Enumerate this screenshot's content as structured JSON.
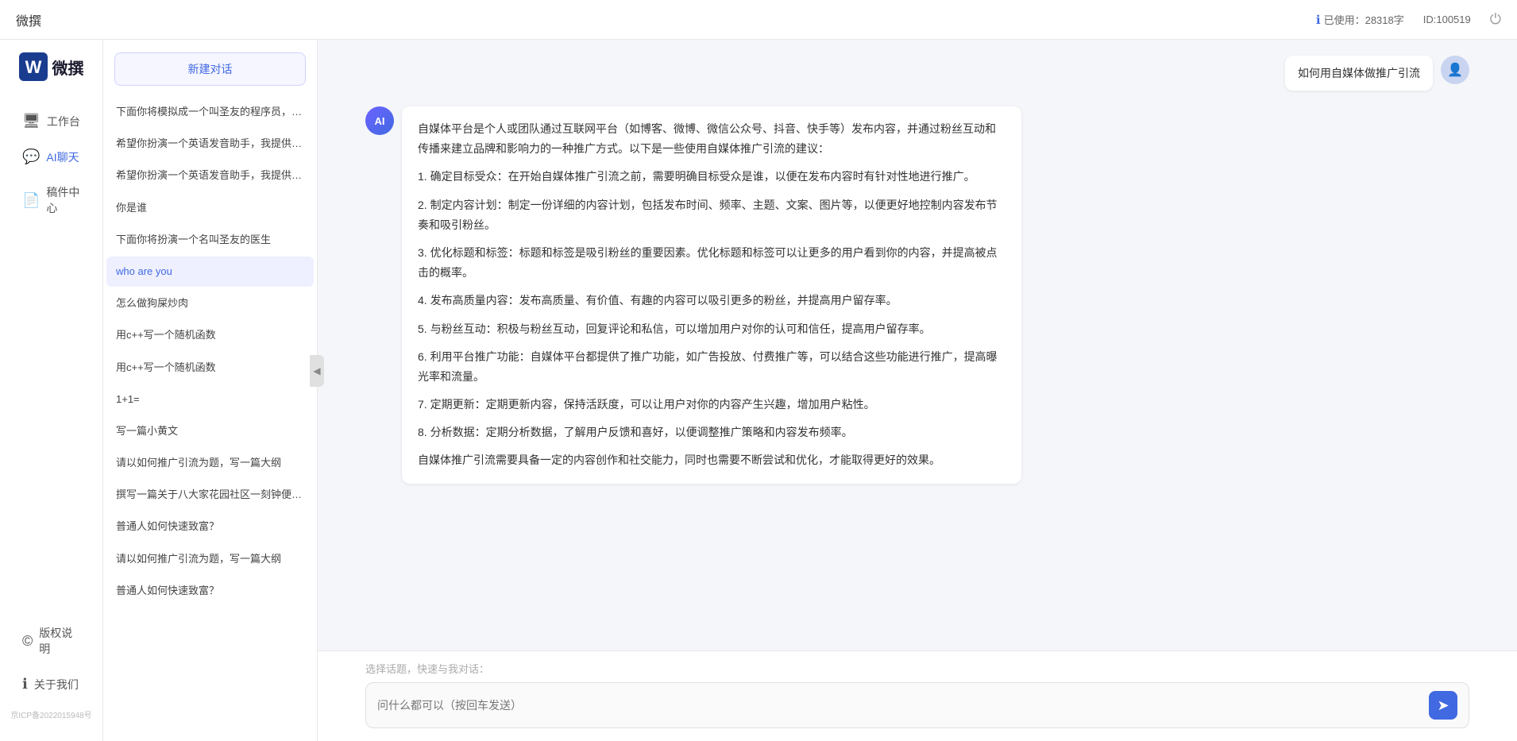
{
  "topbar": {
    "title": "微撰",
    "usage_label": "已使用：28318字",
    "usage_icon": "info-icon",
    "id_label": "ID:100519",
    "power_icon": "power-icon"
  },
  "logo": {
    "text": "微撰",
    "icon_alt": "W logo"
  },
  "nav": {
    "items": [
      {
        "id": "workbench",
        "label": "工作台",
        "icon": "🖥"
      },
      {
        "id": "ai-chat",
        "label": "AI聊天",
        "icon": "💬"
      },
      {
        "id": "drafts",
        "label": "稿件中心",
        "icon": "📄"
      }
    ],
    "bottom_items": [
      {
        "id": "copyright",
        "label": "版权说明",
        "icon": "©"
      },
      {
        "id": "about",
        "label": "关于我们",
        "icon": "ℹ"
      }
    ],
    "icp": "京ICP备2022015948号"
  },
  "conv_panel": {
    "new_btn": "新建对话",
    "items": [
      {
        "id": 1,
        "text": "下面你将模拟成一个叫圣友的程序员，我说...",
        "active": false
      },
      {
        "id": 2,
        "text": "希望你扮演一个英语发音助手，我提供给你...",
        "active": false
      },
      {
        "id": 3,
        "text": "希望你扮演一个英语发音助手，我提供给你...",
        "active": false
      },
      {
        "id": 4,
        "text": "你是谁",
        "active": false
      },
      {
        "id": 5,
        "text": "下面你将扮演一个名叫圣友的医生",
        "active": false
      },
      {
        "id": 6,
        "text": "who are you",
        "active": true
      },
      {
        "id": 7,
        "text": "怎么做狗屎炒肉",
        "active": false
      },
      {
        "id": 8,
        "text": "用c++写一个随机函数",
        "active": false
      },
      {
        "id": 9,
        "text": "用c++写一个随机函数",
        "active": false
      },
      {
        "id": 10,
        "text": "1+1=",
        "active": false
      },
      {
        "id": 11,
        "text": "写一篇小黄文",
        "active": false
      },
      {
        "id": 12,
        "text": "请以如何推广引流为题，写一篇大纲",
        "active": false
      },
      {
        "id": 13,
        "text": "撰写一篇关于八大家花园社区一刻钟便民生...",
        "active": false
      },
      {
        "id": 14,
        "text": "普通人如何快速致富？",
        "active": false
      },
      {
        "id": 15,
        "text": "请以如何推广引流为题，写一篇大纲",
        "active": false
      },
      {
        "id": 16,
        "text": "普通人如何快速致富？",
        "active": false
      }
    ]
  },
  "chat": {
    "user_message": "如何用自媒体做推广引流",
    "ai_response": {
      "paragraphs": [
        "自媒体平台是个人或团队通过互联网平台（如博客、微博、微信公众号、抖音、快手等）发布内容，并通过粉丝互动和传播来建立品牌和影响力的一种推广方式。以下是一些使用自媒体推广引流的建议：",
        "1. 确定目标受众：在开始自媒体推广引流之前，需要明确目标受众是谁，以便在发布内容时有针对性地进行推广。",
        "2. 制定内容计划：制定一份详细的内容计划，包括发布时间、频率、主题、文案、图片等，以便更好地控制内容发布节奏和吸引粉丝。",
        "3. 优化标题和标签：标题和标签是吸引粉丝的重要因素。优化标题和标签可以让更多的用户看到你的内容，并提高被点击的概率。",
        "4. 发布高质量内容：发布高质量、有价值、有趣的内容可以吸引更多的粉丝，并提高用户留存率。",
        "5. 与粉丝互动：积极与粉丝互动，回复评论和私信，可以增加用户对你的认可和信任，提高用户留存率。",
        "6. 利用平台推广功能：自媒体平台都提供了推广功能，如广告投放、付费推广等，可以结合这些功能进行推广，提高曝光率和流量。",
        "7. 定期更新：定期更新内容，保持活跃度，可以让用户对你的内容产生兴趣，增加用户粘性。",
        "8. 分析数据：定期分析数据，了解用户反馈和喜好，以便调整推广策略和内容发布频率。",
        "自媒体推广引流需要具备一定的内容创作和社交能力，同时也需要不断尝试和优化，才能取得更好的效果。"
      ]
    },
    "topic_hint": "选择话题，快速与我对话：",
    "input_placeholder": "问什么都可以（按回车发送）",
    "send_icon": "send-icon"
  },
  "collapse_btn": "◀"
}
